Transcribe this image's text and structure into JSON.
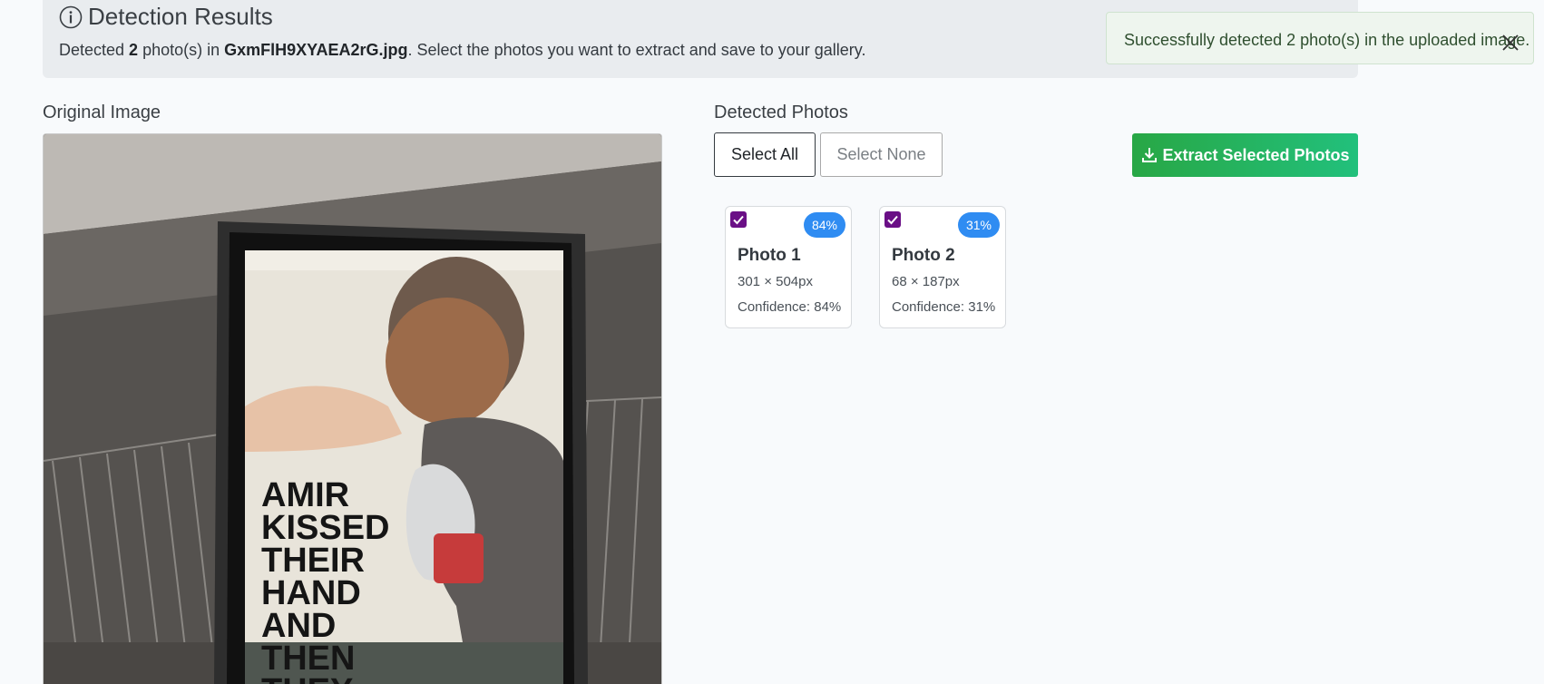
{
  "header": {
    "title": "Detection Results",
    "desc_prefix": "Detected ",
    "count": "2",
    "desc_mid": " photo(s) in ",
    "filename": "GxmFlH9XYAEA2rG.jpg",
    "desc_suffix": ". Select the photos you want to extract and save to your gallery."
  },
  "toast": {
    "message": "Successfully detected 2 photo(s) in the uploaded image."
  },
  "original": {
    "label": "Original Image",
    "poster_lines": [
      "AMIR",
      "KISSED",
      "THEIR",
      "HAND",
      "AND",
      "THEN",
      "THEY"
    ]
  },
  "detected": {
    "label": "Detected Photos",
    "select_all": "Select All",
    "select_none": "Select None",
    "extract": "Extract Selected Photos",
    "photos": [
      {
        "title": "Photo 1",
        "dims": "301 × 504px",
        "confidence": "Confidence: 84%",
        "badge": "84%",
        "checked": true
      },
      {
        "title": "Photo 2",
        "dims": "68 × 187px",
        "confidence": "Confidence: 31%",
        "badge": "31%",
        "checked": true
      }
    ]
  },
  "colors": {
    "accent_green": "#28a745",
    "badge_blue": "#2f8cf2",
    "checkbox_purple": "#6a0f86"
  },
  "icons": [
    "info-icon",
    "close-icon",
    "download-icon",
    "check-icon"
  ]
}
